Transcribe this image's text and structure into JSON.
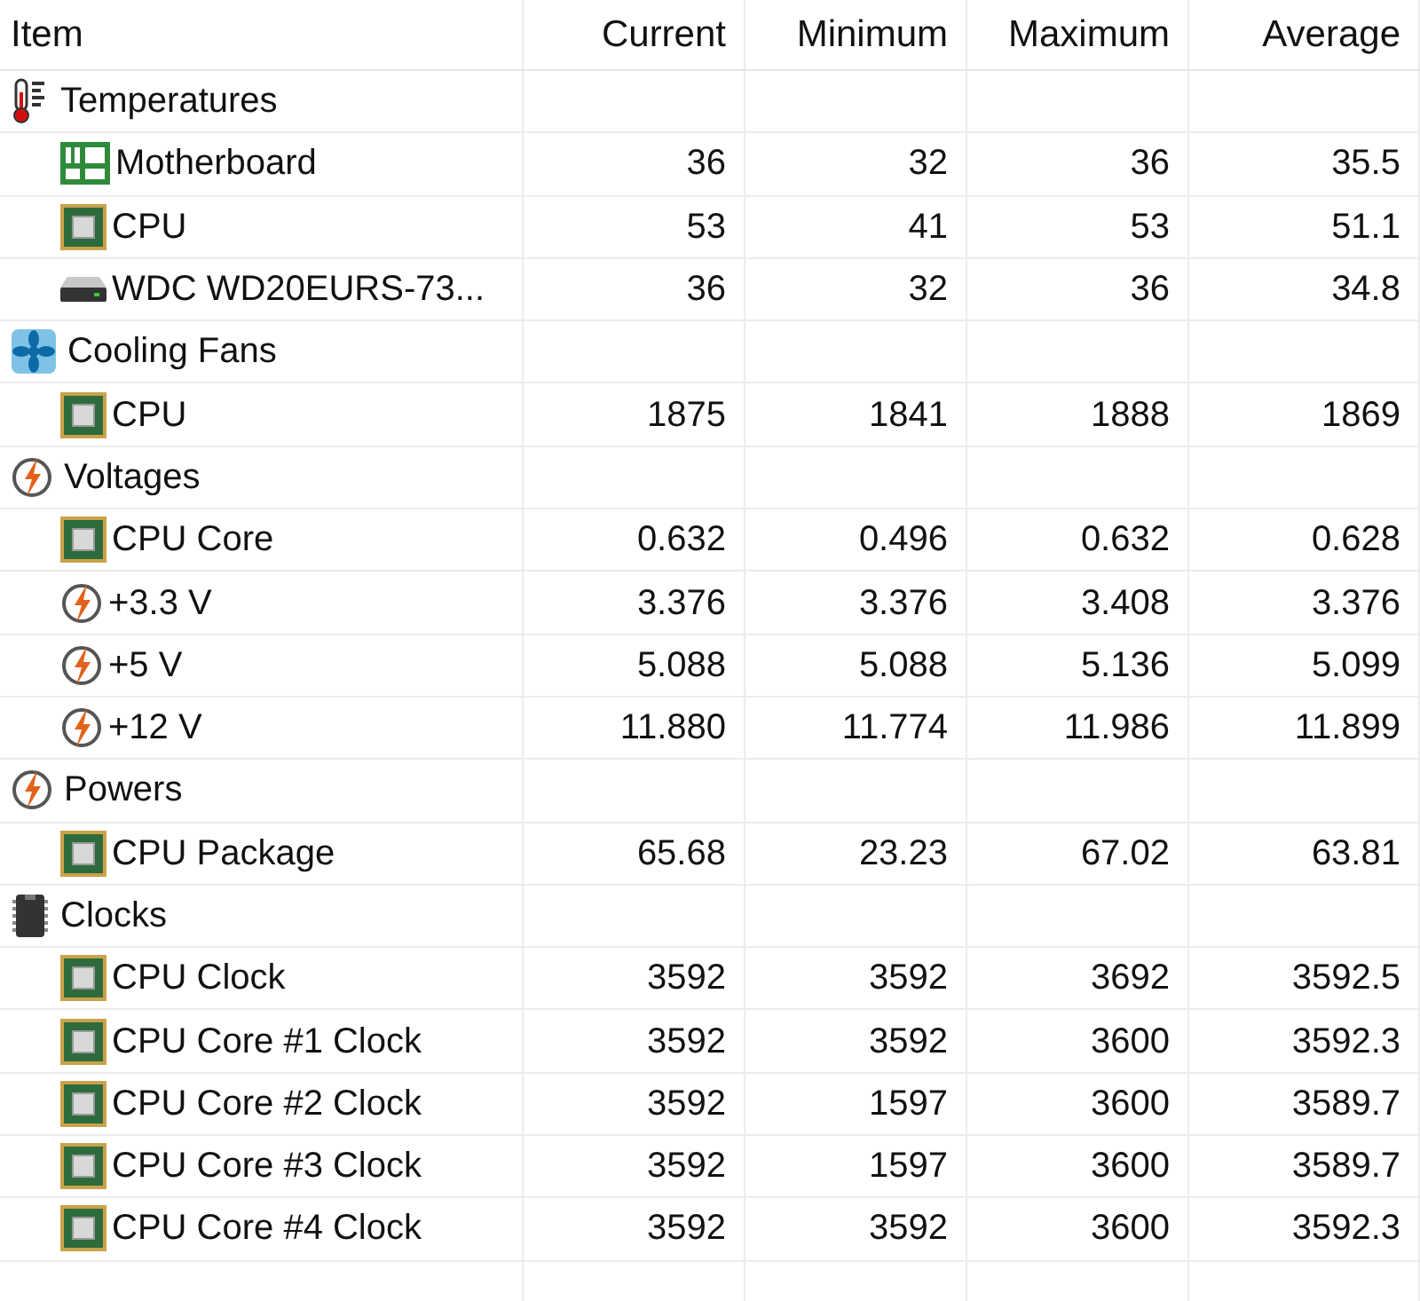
{
  "columns": [
    "Item",
    "Current",
    "Minimum",
    "Maximum",
    "Average"
  ],
  "groups": [
    {
      "label": "Temperatures",
      "kind": "thermometer",
      "children": [
        {
          "label": "Motherboard",
          "kind": "board",
          "values": [
            "36",
            "32",
            "36",
            "35.5"
          ]
        },
        {
          "label": "CPU",
          "kind": "cpu",
          "values": [
            "53",
            "41",
            "53",
            "51.1"
          ]
        },
        {
          "label": "WDC WD20EURS-73...",
          "kind": "drive",
          "values": [
            "36",
            "32",
            "36",
            "34.8"
          ]
        }
      ]
    },
    {
      "label": "Cooling Fans",
      "kind": "fan",
      "children": [
        {
          "label": "CPU",
          "kind": "cpu",
          "values": [
            "1875",
            "1841",
            "1888",
            "1869"
          ]
        }
      ]
    },
    {
      "label": "Voltages",
      "kind": "bolt",
      "children": [
        {
          "label": "CPU Core",
          "kind": "cpu",
          "values": [
            "0.632",
            "0.496",
            "0.632",
            "0.628"
          ]
        },
        {
          "label": "+3.3 V",
          "kind": "bolt",
          "values": [
            "3.376",
            "3.376",
            "3.408",
            "3.376"
          ]
        },
        {
          "label": "+5 V",
          "kind": "bolt",
          "values": [
            "5.088",
            "5.088",
            "5.136",
            "5.099"
          ]
        },
        {
          "label": "+12 V",
          "kind": "bolt",
          "values": [
            "11.880",
            "11.774",
            "11.986",
            "11.899"
          ]
        }
      ]
    },
    {
      "label": "Powers",
      "kind": "bolt",
      "children": [
        {
          "label": "CPU Package",
          "kind": "cpu",
          "values": [
            "65.68",
            "23.23",
            "67.02",
            "63.81"
          ]
        }
      ]
    },
    {
      "label": "Clocks",
      "kind": "memory",
      "children": [
        {
          "label": "CPU Clock",
          "kind": "cpu",
          "values": [
            "3592",
            "3592",
            "3692",
            "3592.5"
          ]
        },
        {
          "label": "CPU Core #1 Clock",
          "kind": "cpu",
          "values": [
            "3592",
            "3592",
            "3600",
            "3592.3"
          ]
        },
        {
          "label": "CPU Core #2 Clock",
          "kind": "cpu",
          "values": [
            "3592",
            "1597",
            "3600",
            "3589.7"
          ]
        },
        {
          "label": "CPU Core #3 Clock",
          "kind": "cpu",
          "values": [
            "3592",
            "1597",
            "3600",
            "3589.7"
          ]
        },
        {
          "label": "CPU Core #4 Clock",
          "kind": "cpu",
          "values": [
            "3592",
            "3592",
            "3600",
            "3592.3"
          ]
        }
      ]
    }
  ]
}
